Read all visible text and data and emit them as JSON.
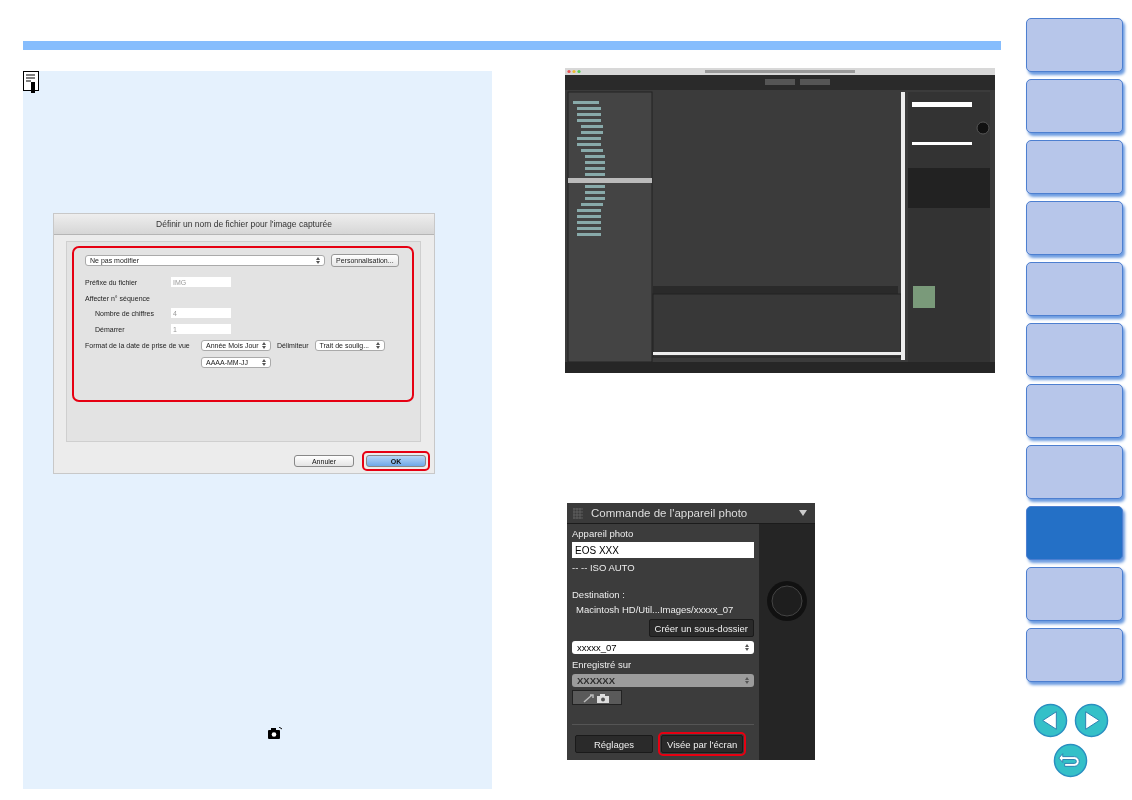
{
  "nav_tabs": [
    {
      "selected": false
    },
    {
      "selected": false
    },
    {
      "selected": false
    },
    {
      "selected": false
    },
    {
      "selected": false
    },
    {
      "selected": false
    },
    {
      "selected": false
    },
    {
      "selected": false
    },
    {
      "selected": true
    },
    {
      "selected": false
    },
    {
      "selected": false
    }
  ],
  "dialog": {
    "title": "Définir un nom de fichier pour l'image capturée",
    "highlighted": true,
    "preset_select": "Ne pas modifier",
    "customize_button": "Personnalisation...",
    "prefix": {
      "label": "Préfixe du fichier",
      "value": "IMG"
    },
    "sequence_label": "Affecter n° séquence",
    "digits": {
      "label": "Nombre de chiffres",
      "value": "4"
    },
    "start": {
      "label": "Démarrer",
      "value": "1"
    },
    "date_label": "Format de la date de prise de vue",
    "date_select": "Année Mois Jour",
    "delimiter_label": "Délimiteur",
    "delimiter_select": "Trait de soulig...",
    "order_select": "AAAA-MM-JJ",
    "buttons": [
      {
        "kind": "cancel",
        "label": "Annuler",
        "highlighted": false
      },
      {
        "kind": "default",
        "label": "OK",
        "highlighted": true
      }
    ]
  },
  "camera_panel": {
    "title": "Commande de l'appareil photo",
    "camera_label": "Appareil photo",
    "camera_value": "EOS XXX",
    "status": "--  --  ISO AUTO",
    "destination_label": "Destination :",
    "destination_path": "Macintosh HD/Util...Images/xxxxx_07",
    "subfolder_button": "Créer un sous-dossier",
    "folder_select": "xxxxx_07",
    "saved_label": "Enregistré sur",
    "media_select": "XXXXXX",
    "media_disabled": true,
    "buttons": [
      {
        "label": "Réglages",
        "highlighted": false
      },
      {
        "label": "Visée par l'écran",
        "highlighted": true
      }
    ]
  }
}
